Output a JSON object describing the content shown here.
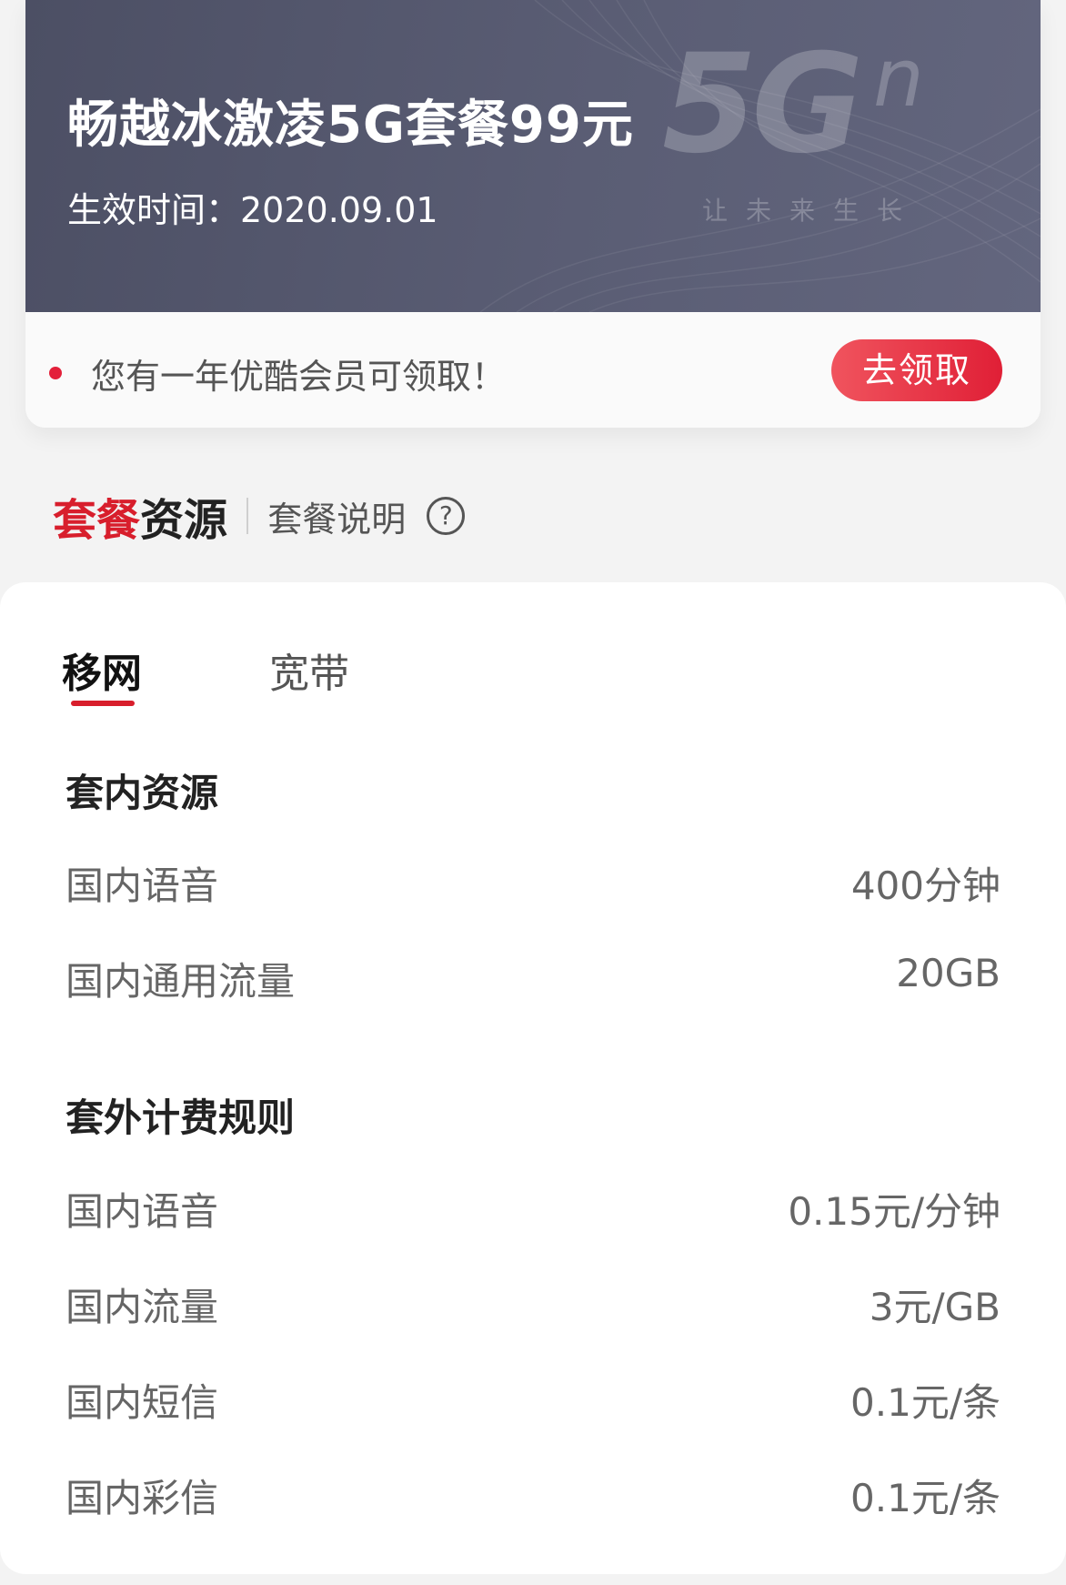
{
  "plan": {
    "title": "畅越冰激凌5G套餐99元",
    "effective_date": "生效时间：2020.09.01",
    "logo_text": "5G",
    "logo_sup": "n",
    "logo_slogan": "让未来生长"
  },
  "notice": {
    "text": "您有一年优酷会员可领取！",
    "button_label": "去领取",
    "dot_color": "#e3203a"
  },
  "section": {
    "title_red": "套餐",
    "title_dark": "资源",
    "description_link": "套餐说明",
    "help_icon": "?"
  },
  "tabs": [
    {
      "label": "移网",
      "active": true
    },
    {
      "label": "宽带",
      "active": false
    }
  ],
  "included": {
    "title": "套内资源",
    "rows": [
      {
        "label": "国内语音",
        "value": "400分钟"
      },
      {
        "label": "国内通用流量",
        "value": "20GB"
      }
    ]
  },
  "overage": {
    "title": "套外计费规则",
    "rows": [
      {
        "label": "国内语音",
        "value": "0.15元/分钟"
      },
      {
        "label": "国内流量",
        "value": "3元/GB"
      },
      {
        "label": "国内短信",
        "value": "0.1元/条"
      },
      {
        "label": "国内彩信",
        "value": "0.1元/条"
      }
    ]
  },
  "colors": {
    "accent_red": "#d81e2c",
    "banner": "#50536a",
    "button_red": "#e01f36"
  }
}
